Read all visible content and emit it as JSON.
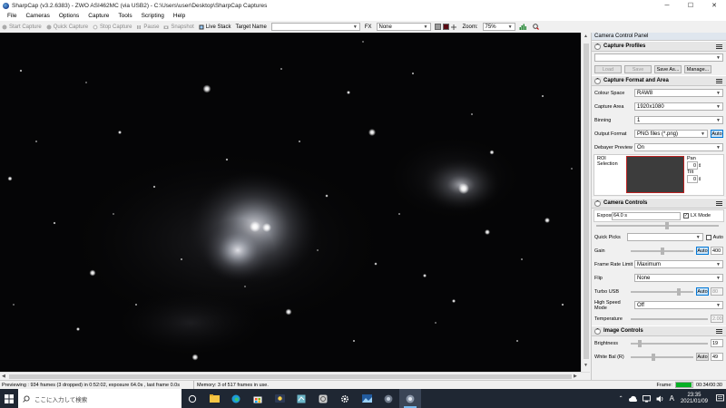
{
  "window": {
    "title": "SharpCap (v3.2.6383) - ZWO ASI462MC (via USB2) - C:\\Users\\user\\Desktop\\SharpCap Captures",
    "minimize": "─",
    "maximize": "☐",
    "close": "✕"
  },
  "menu": [
    "File",
    "Cameras",
    "Options",
    "Capture",
    "Tools",
    "Scripting",
    "Help"
  ],
  "toolbar": {
    "start_capture": "Start Capture",
    "quick_capture": "Quick Capture",
    "stop_capture": "Stop Capture",
    "pause": "Pause",
    "snapshot": "Snapshot",
    "live_stack": "Live Stack",
    "target_name_label": "Target Name",
    "target_name_value": "",
    "fx_label": "FX",
    "fx_value": "None",
    "zoom_label": "Zoom:",
    "zoom_value": "75%"
  },
  "panel": {
    "header": "Camera Control Panel",
    "capture_profiles": {
      "title": "Capture Profiles",
      "selected": "",
      "load": "Load",
      "save": "Save",
      "save_as": "Save As...",
      "manage": "Manage..."
    },
    "format": {
      "title": "Capture Format and Area",
      "colour_space_label": "Colour Space",
      "colour_space": "RAW8",
      "capture_area_label": "Capture Area",
      "capture_area": "1920x1080",
      "binning_label": "Binning",
      "binning": "1",
      "output_format_label": "Output Format",
      "output_format": "PNG files (*.png)",
      "auto": "Auto",
      "debayer_label": "Debayer Preview",
      "debayer": "On",
      "roi_label": "ROI Selection",
      "pan_label": "Pan",
      "pan_value": "0",
      "tilt_label": "Tilt",
      "tilt_value": "0"
    },
    "camera": {
      "title": "Camera Controls",
      "exposure_label": "Exposure",
      "exposure_value": "64.0 s",
      "lx_mode": "LX Mode",
      "quick_picks_label": "Quick Picks",
      "quick_picks_value": "",
      "auto": "Auto",
      "gain_label": "Gain",
      "gain_value": "400",
      "gain_level": 0.5,
      "frame_rate_label": "Frame Rate Limit",
      "frame_rate": "Maximum",
      "flip_label": "Flip",
      "flip": "None",
      "turbo_label": "Turbo USB",
      "turbo_value": "80",
      "turbo_level": 0.78,
      "high_speed_label": "High Speed Mode",
      "high_speed": "Off",
      "temperature_label": "Temperature",
      "temperature": "2.00"
    },
    "image": {
      "title": "Image Controls",
      "brightness_label": "Brightness",
      "brightness_value": "19",
      "brightness_level": 0.1,
      "wb_label": "White Bal (R)",
      "wb_value": "49",
      "wb_level": 0.35,
      "auto": "Auto"
    }
  },
  "status": {
    "preview": "Previewing : 934 frames (3 dropped) in 0:52:02, exposure 64.0s , last frame 0.0s",
    "memory": "Memory: 3 of 517 frames in use.",
    "frame_label": "Frame:",
    "frame_time": "00:34/00:30",
    "frame_progress": 0.95
  },
  "taskbar": {
    "search_placeholder": "ここに入力して検索",
    "time": "23:35",
    "date": "2021/01/09",
    "ime": "A"
  },
  "colors": {
    "accent": "#0078d7",
    "progress": "#06b025",
    "taskbar": "#1f2733"
  }
}
